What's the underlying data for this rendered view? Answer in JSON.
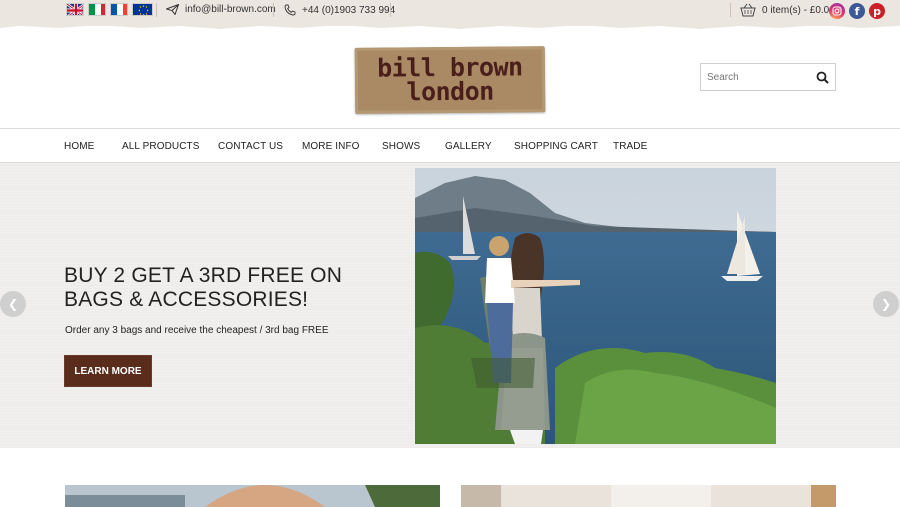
{
  "topbar": {
    "flags": [
      {
        "name": "uk-flag"
      },
      {
        "name": "italy-flag"
      },
      {
        "name": "france-flag"
      },
      {
        "name": "eu-flag"
      }
    ],
    "email": "info@bill-brown.com",
    "phone": "+44 (0)1903 733 994",
    "cart": "0 item(s) - £0.00",
    "social": [
      {
        "name": "instagram-icon",
        "color": "#c13584"
      },
      {
        "name": "facebook-icon",
        "color": "#3b5998"
      },
      {
        "name": "pinterest-icon",
        "color": "#cb2027"
      }
    ]
  },
  "header": {
    "logo_line1": "bill brown",
    "logo_line2": "london",
    "search_placeholder": "Search"
  },
  "nav": {
    "items": [
      "HOME",
      "ALL PRODUCTS",
      "CONTACT US",
      "MORE INFO",
      "SHOWS",
      "GALLERY",
      "SHOPPING CART",
      "TRADE"
    ]
  },
  "hero": {
    "title": "BUY 2 GET A 3RD FREE ON BAGS & ACCESSORIES!",
    "subtitle": "Order any 3 bags and receive the cheapest / 3rd bag FREE",
    "button": "LEARN MORE"
  },
  "colors": {
    "topbar_bg": "#ece6e0",
    "brand_brown": "#5a2c1c",
    "hero_bg": "#f0efed"
  }
}
